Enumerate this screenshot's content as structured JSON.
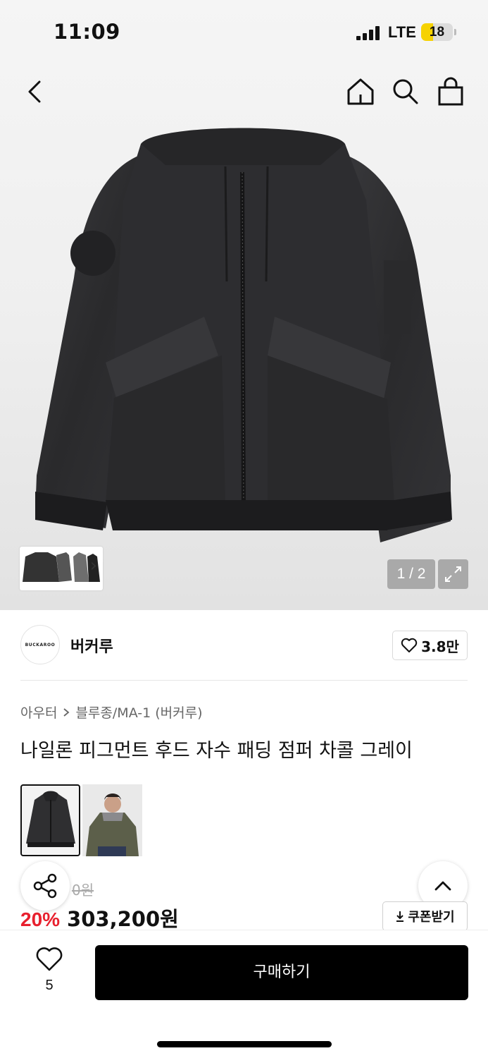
{
  "status_bar": {
    "time": "11:09",
    "network": "LTE",
    "battery": "18"
  },
  "nav": {
    "icons": [
      "back-arrow-icon",
      "home-icon",
      "search-icon",
      "shopping-bag-icon"
    ]
  },
  "gallery": {
    "page_indicator": "1 / 2",
    "thumb_more": "›"
  },
  "brand": {
    "logo_text": "BUCKAROO",
    "name": "버커루",
    "like_count": "3.8만"
  },
  "breadcrumb": {
    "category": "아우터",
    "sub_category": "블루종/MA-1 (버커루)"
  },
  "product": {
    "title": "나일론 피그먼트 후드 자수 패딩 점퍼 차콜 그레이",
    "original_price_visible": "0원",
    "discount": "20%",
    "price": "303,200원"
  },
  "coupon": {
    "label": "쿠폰받기"
  },
  "bottom_bar": {
    "wish_count": "5",
    "buy_label": "구매하기"
  },
  "colors": {
    "discount": "#e8202e",
    "buy_button": "#000000",
    "jacket": "#2b2b2d"
  }
}
